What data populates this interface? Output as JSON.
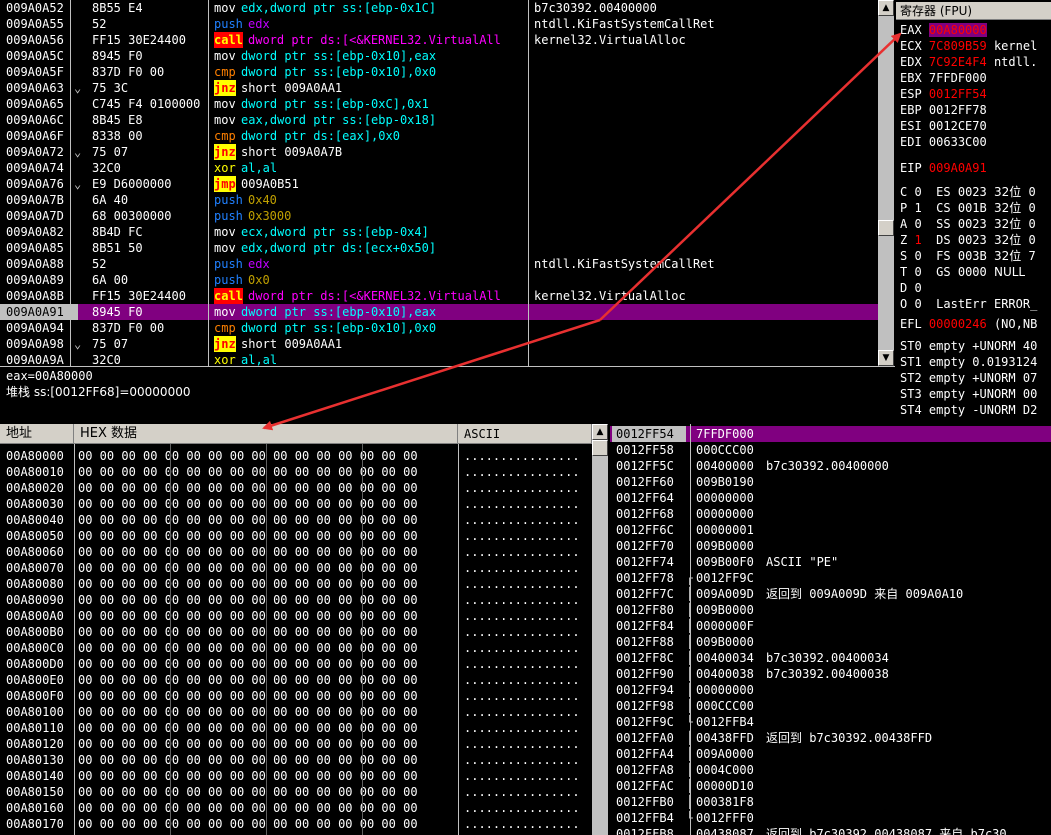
{
  "disasm": {
    "rows": [
      {
        "addr": "009A0A52",
        "hex": "8B55 E4",
        "mn": "mov",
        "ops": "edx,dword ptr ss:[ebp-0x1C]",
        "cmt": "b7c30392.00400000",
        "style": "mov",
        "mark": ""
      },
      {
        "addr": "009A0A55",
        "hex": "52",
        "mn": "push",
        "ops": "edx",
        "cmt": "ntdll.KiFastSystemCallRet",
        "style": "push",
        "mark": ""
      },
      {
        "addr": "009A0A56",
        "hex": "FF15 30E24400",
        "mn": "call",
        "ops": "dword ptr ds:[<&KERNEL32.VirtualAll",
        "cmt": "kernel32.VirtualAlloc",
        "style": "call",
        "mark": ""
      },
      {
        "addr": "009A0A5C",
        "hex": "8945 F0",
        "mn": "mov",
        "ops": "dword ptr ss:[ebp-0x10],eax",
        "cmt": "",
        "style": "mov",
        "mark": ""
      },
      {
        "addr": "009A0A5F",
        "hex": "837D F0 00",
        "mn": "cmp",
        "ops": "dword ptr ss:[ebp-0x10],0x0",
        "cmt": "",
        "style": "cmp",
        "mark": ""
      },
      {
        "addr": "009A0A63",
        "hex": "75 3C",
        "mn": "jnz",
        "ops": "short 009A0AA1",
        "cmt": "",
        "style": "jnz",
        "mark": "v"
      },
      {
        "addr": "009A0A65",
        "hex": "C745 F4 0100000",
        "mn": "mov",
        "ops": "dword ptr ss:[ebp-0xC],0x1",
        "cmt": "",
        "style": "mov",
        "mark": ""
      },
      {
        "addr": "009A0A6C",
        "hex": "8B45 E8",
        "mn": "mov",
        "ops": "eax,dword ptr ss:[ebp-0x18]",
        "cmt": "",
        "style": "mov",
        "mark": ""
      },
      {
        "addr": "009A0A6F",
        "hex": "8338 00",
        "mn": "cmp",
        "ops": "dword ptr ds:[eax],0x0",
        "cmt": "",
        "style": "cmp",
        "mark": ""
      },
      {
        "addr": "009A0A72",
        "hex": "75 07",
        "mn": "jnz",
        "ops": "short 009A0A7B",
        "cmt": "",
        "style": "jnz",
        "mark": "v"
      },
      {
        "addr": "009A0A74",
        "hex": "32C0",
        "mn": "xor",
        "ops": "al,al",
        "cmt": "",
        "style": "xor",
        "mark": ""
      },
      {
        "addr": "009A0A76",
        "hex": "E9 D6000000",
        "mn": "jmp",
        "ops": "009A0B51",
        "cmt": "",
        "style": "jmp",
        "mark": "v"
      },
      {
        "addr": "009A0A7B",
        "hex": "6A 40",
        "mn": "push",
        "ops": "0x40",
        "cmt": "",
        "style": "push",
        "mark": ""
      },
      {
        "addr": "009A0A7D",
        "hex": "68 00300000",
        "mn": "push",
        "ops": "0x3000",
        "cmt": "",
        "style": "push",
        "mark": ""
      },
      {
        "addr": "009A0A82",
        "hex": "8B4D FC",
        "mn": "mov",
        "ops": "ecx,dword ptr ss:[ebp-0x4]",
        "cmt": "",
        "style": "mov",
        "mark": ""
      },
      {
        "addr": "009A0A85",
        "hex": "8B51 50",
        "mn": "mov",
        "ops": "edx,dword ptr ds:[ecx+0x50]",
        "cmt": "",
        "style": "mov",
        "mark": ""
      },
      {
        "addr": "009A0A88",
        "hex": "52",
        "mn": "push",
        "ops": "edx",
        "cmt": "ntdll.KiFastSystemCallRet",
        "style": "push",
        "mark": ""
      },
      {
        "addr": "009A0A89",
        "hex": "6A 00",
        "mn": "push",
        "ops": "0x0",
        "cmt": "",
        "style": "push",
        "mark": ""
      },
      {
        "addr": "009A0A8B",
        "hex": "FF15 30E24400",
        "mn": "call",
        "ops": "dword ptr ds:[<&KERNEL32.VirtualAll",
        "cmt": "kernel32.VirtualAlloc",
        "style": "call",
        "mark": ""
      },
      {
        "addr": "009A0A91",
        "hex": "8945 F0",
        "mn": "mov",
        "ops": "dword ptr ss:[ebp-0x10],eax",
        "cmt": "",
        "style": "mov",
        "mark": "",
        "hl": true
      },
      {
        "addr": "009A0A94",
        "hex": "837D F0 00",
        "mn": "cmp",
        "ops": "dword ptr ss:[ebp-0x10],0x0",
        "cmt": "",
        "style": "cmp",
        "mark": ""
      },
      {
        "addr": "009A0A98",
        "hex": "75 07",
        "mn": "jnz",
        "ops": "short 009A0AA1",
        "cmt": "",
        "style": "jnz",
        "mark": "v"
      },
      {
        "addr": "009A0A9A",
        "hex": "32C0",
        "mn": "xor",
        "ops": "al,al",
        "cmt": "",
        "style": "xor",
        "mark": ""
      }
    ]
  },
  "info": {
    "line1": "eax=00A80000",
    "line2": "堆栈 ss:[0012FF68]=00000000"
  },
  "registers": {
    "title": "寄存器 (FPU)",
    "rows": [
      {
        "name": "EAX",
        "val": "00A80000",
        "extra": "",
        "hl": true
      },
      {
        "name": "ECX",
        "val": "7C809B59",
        "extra": "kernel",
        "red": true
      },
      {
        "name": "EDX",
        "val": "7C92E4F4",
        "extra": "ntdll.",
        "red": true
      },
      {
        "name": "EBX",
        "val": "7FFDF000",
        "extra": ""
      },
      {
        "name": "ESP",
        "val": "0012FF54",
        "extra": "",
        "red": true
      },
      {
        "name": "EBP",
        "val": "0012FF78",
        "extra": ""
      },
      {
        "name": "ESI",
        "val": "0012CE70",
        "extra": ""
      },
      {
        "name": "EDI",
        "val": "00633C00",
        "extra": ""
      }
    ],
    "eip": {
      "name": "EIP",
      "val": "009A0A91"
    },
    "flags": [
      {
        "f": "C",
        "v": "0",
        "seg": "ES",
        "sv": "0023",
        "bits": "32位",
        "lim": "0"
      },
      {
        "f": "P",
        "v": "1",
        "seg": "CS",
        "sv": "001B",
        "bits": "32位",
        "lim": "0"
      },
      {
        "f": "A",
        "v": "0",
        "seg": "SS",
        "sv": "0023",
        "bits": "32位",
        "lim": "0"
      },
      {
        "f": "Z",
        "v": "1",
        "seg": "DS",
        "sv": "0023",
        "bits": "32位",
        "lim": "0",
        "red": true
      },
      {
        "f": "S",
        "v": "0",
        "seg": "FS",
        "sv": "003B",
        "bits": "32位",
        "lim": "7"
      },
      {
        "f": "T",
        "v": "0",
        "seg": "GS",
        "sv": "0000",
        "bits": "NULL",
        "lim": ""
      },
      {
        "f": "D",
        "v": "0",
        "seg": "",
        "sv": "",
        "bits": "",
        "lim": ""
      },
      {
        "f": "O",
        "v": "0",
        "seg": "LastErr",
        "sv": "ERROR_",
        "bits": "",
        "lim": ""
      }
    ],
    "efl": {
      "name": "EFL",
      "val": "00000246",
      "extra": "(NO,NB"
    },
    "fpu": [
      {
        "name": "ST0",
        "val": "empty +UNORM 40"
      },
      {
        "name": "ST1",
        "val": "empty 0.0193124"
      },
      {
        "name": "ST2",
        "val": "empty +UNORM 07"
      },
      {
        "name": "ST3",
        "val": "empty +UNORM 00"
      },
      {
        "name": "ST4",
        "val": "empty -UNORM D2"
      }
    ]
  },
  "dump": {
    "headers": {
      "addr": "地址",
      "hex": "HEX 数据",
      "ascii": "ASCII"
    },
    "hex_line": "00 00 00 00 00 00 00 00 00 00 00 00 00 00 00 00",
    "ascii_line": "................",
    "rows": [
      "00A80000",
      "00A80010",
      "00A80020",
      "00A80030",
      "00A80040",
      "00A80050",
      "00A80060",
      "00A80070",
      "00A80080",
      "00A80090",
      "00A800A0",
      "00A800B0",
      "00A800C0",
      "00A800D0",
      "00A800E0",
      "00A800F0",
      "00A80100",
      "00A80110",
      "00A80120",
      "00A80130",
      "00A80140",
      "00A80150",
      "00A80160",
      "00A80170"
    ]
  },
  "stack": {
    "rows": [
      {
        "addr": "0012FF54",
        "val": "7FFDF000",
        "cmt": "",
        "hl": true,
        "br": ""
      },
      {
        "addr": "0012FF58",
        "val": "000CCC00",
        "cmt": "",
        "br": ""
      },
      {
        "addr": "0012FF5C",
        "val": "00400000",
        "cmt": "b7c30392.00400000",
        "br": ""
      },
      {
        "addr": "0012FF60",
        "val": "009B0190",
        "cmt": "",
        "br": ""
      },
      {
        "addr": "0012FF64",
        "val": "00000000",
        "cmt": "",
        "br": ""
      },
      {
        "addr": "0012FF68",
        "val": "00000000",
        "cmt": "",
        "br": ""
      },
      {
        "addr": "0012FF6C",
        "val": "00000001",
        "cmt": "",
        "br": ""
      },
      {
        "addr": "0012FF70",
        "val": "009B0000",
        "cmt": "",
        "br": ""
      },
      {
        "addr": "0012FF74",
        "val": "009B00F0",
        "cmt": "ASCII \"PE\"",
        "br": ""
      },
      {
        "addr": "0012FF78",
        "val": "0012FF9C",
        "cmt": "",
        "br": "top"
      },
      {
        "addr": "0012FF7C",
        "val": "009A009D",
        "cmt": "返回到 009A009D 来自 009A0A10",
        "br": "mid"
      },
      {
        "addr": "0012FF80",
        "val": "009B0000",
        "cmt": "",
        "br": "mid"
      },
      {
        "addr": "0012FF84",
        "val": "0000000F",
        "cmt": "",
        "br": "mid"
      },
      {
        "addr": "0012FF88",
        "val": "009B0000",
        "cmt": "",
        "br": "mid"
      },
      {
        "addr": "0012FF8C",
        "val": "00400034",
        "cmt": "b7c30392.00400034",
        "br": "mid"
      },
      {
        "addr": "0012FF90",
        "val": "00400038",
        "cmt": "b7c30392.00400038",
        "br": "mid"
      },
      {
        "addr": "0012FF94",
        "val": "00000000",
        "cmt": "",
        "br": "mid"
      },
      {
        "addr": "0012FF98",
        "val": "000CCC00",
        "cmt": "",
        "br": "mid"
      },
      {
        "addr": "0012FF9C",
        "val": "0012FFB4",
        "cmt": "",
        "br": "bot"
      },
      {
        "addr": "0012FFA0",
        "val": "00438FFD",
        "cmt": "返回到 b7c30392.00438FFD",
        "br": "mid2"
      },
      {
        "addr": "0012FFA4",
        "val": "009A0000",
        "cmt": "",
        "br": "mid2"
      },
      {
        "addr": "0012FFA8",
        "val": "0004C000",
        "cmt": "",
        "br": "mid2"
      },
      {
        "addr": "0012FFAC",
        "val": "00000D10",
        "cmt": "",
        "br": "mid2"
      },
      {
        "addr": "0012FFB0",
        "val": "000381F8",
        "cmt": "",
        "br": "mid2"
      },
      {
        "addr": "0012FFB4",
        "val": "0012FFF0",
        "cmt": "",
        "br": "bot"
      },
      {
        "addr": "0012FFB8",
        "val": "00438087",
        "cmt": "返回到 b7c30392.00438087 来自 b7c30",
        "br": ""
      }
    ]
  },
  "colors": {
    "highlight": "#800080",
    "arrow": "#e83030",
    "panel": "#000000",
    "header": "#d4d0c8"
  }
}
